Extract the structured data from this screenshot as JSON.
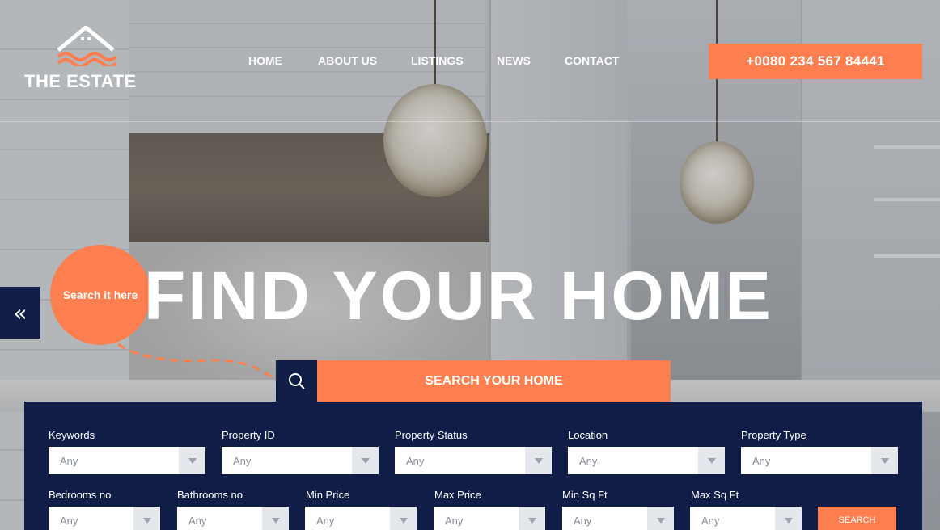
{
  "brand": {
    "name": "THE ESTATE",
    "accent_color": "#fd7e4e",
    "navy_color": "#101e47"
  },
  "nav": {
    "items": [
      {
        "label": "HOME"
      },
      {
        "label": "ABOUT US"
      },
      {
        "label": "LISTINGS"
      },
      {
        "label": "NEWS"
      },
      {
        "label": "CONTACT"
      }
    ]
  },
  "header": {
    "phone": "+0080 234 567 84441"
  },
  "hero": {
    "title": "FIND YOUR HOME",
    "bubble_text": "Search it here",
    "prev_arrow": "«",
    "prev_icon": "double-chevron-left-icon"
  },
  "search_tab": {
    "label": "SEARCH YOUR HOME",
    "icon": "search-icon"
  },
  "search_form": {
    "row1": [
      {
        "label": "Keywords",
        "value": "Any"
      },
      {
        "label": "Property ID",
        "value": "Any"
      },
      {
        "label": "Property Status",
        "value": "Any"
      },
      {
        "label": "Location",
        "value": "Any"
      },
      {
        "label": "Property Type",
        "value": "Any"
      }
    ],
    "row2": [
      {
        "label": "Bedrooms no",
        "value": "Any"
      },
      {
        "label": "Bathrooms no",
        "value": "Any"
      },
      {
        "label": "Min Price",
        "value": "Any"
      },
      {
        "label": "Max Price",
        "value": "Any"
      },
      {
        "label": "Min Sq Ft",
        "value": "Any"
      },
      {
        "label": "Max Sq Ft",
        "value": "Any"
      }
    ],
    "submit_label": "SEARCH"
  }
}
